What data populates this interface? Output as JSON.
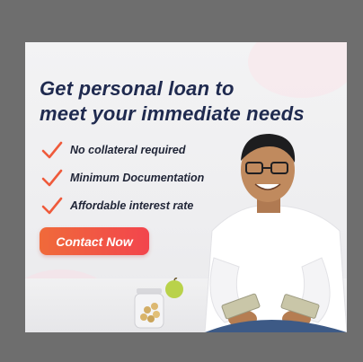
{
  "ad": {
    "headline_line1": "Get personal loan to",
    "headline_line2": "meet your immediate needs",
    "features": [
      "No collateral required",
      "Minimum Documentation",
      "Affordable interest rate"
    ],
    "cta_label": "Contact Now"
  },
  "colors": {
    "headline": "#1f2a4f",
    "accent_orange": "#f06a3a",
    "accent_red": "#f2454d",
    "check": "#ef5a3b"
  },
  "icons": {
    "check": "check-icon"
  }
}
